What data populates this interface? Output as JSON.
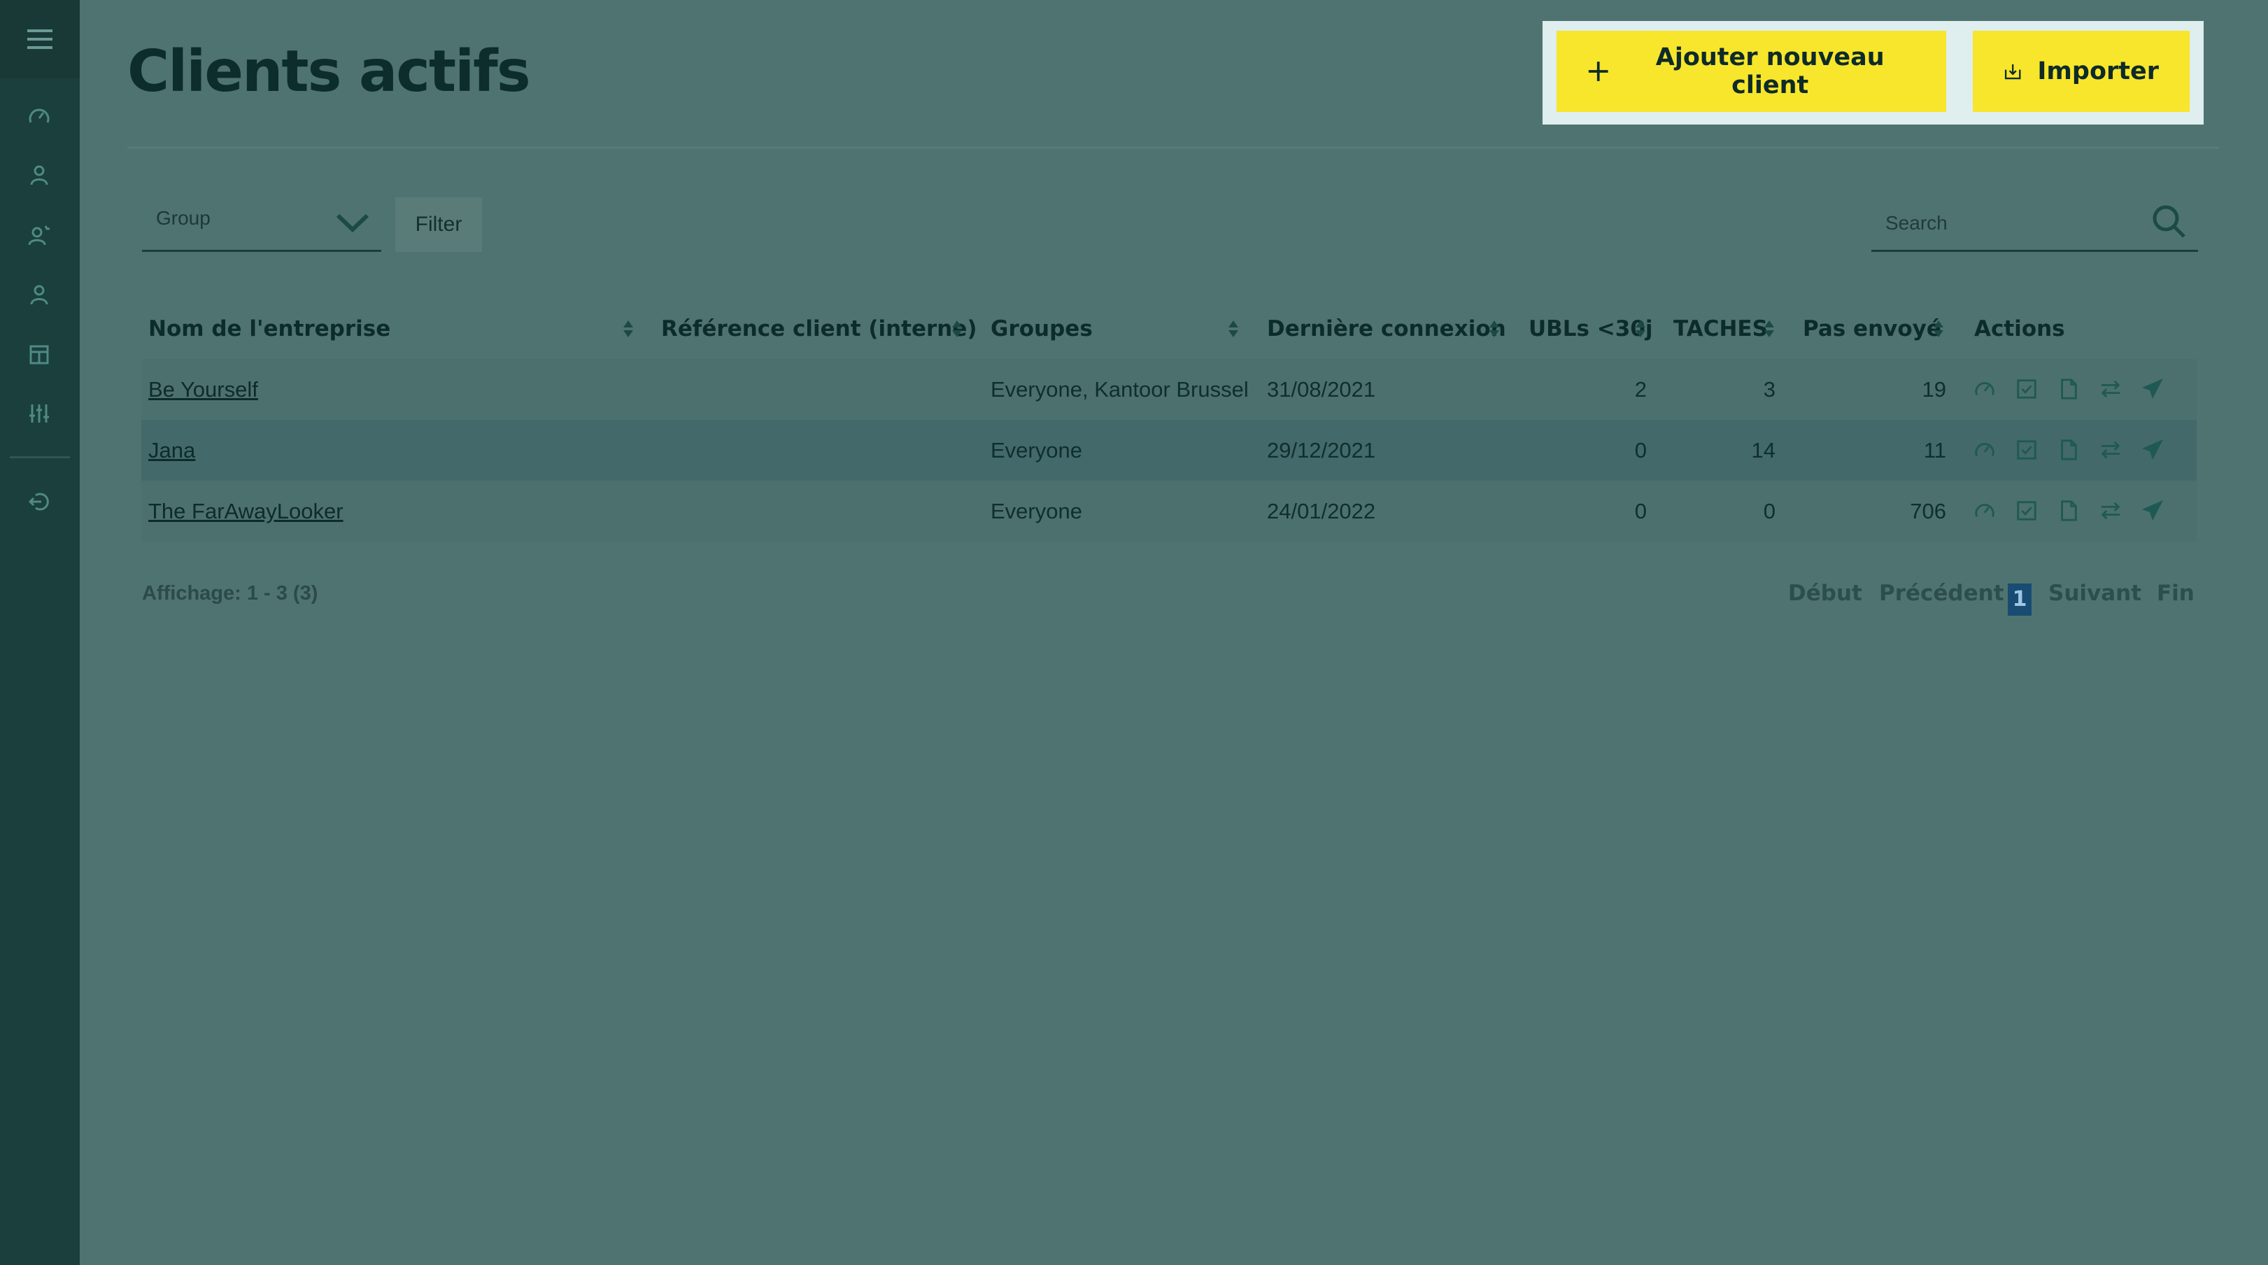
{
  "sidebar": {
    "icons": [
      "menu-icon",
      "dashboard-icon",
      "user-icon",
      "user-star-icon",
      "user-group-icon",
      "shop-icon",
      "sliders-icon",
      "logout-icon"
    ]
  },
  "header": {
    "title": "Clients actifs",
    "add_button": "Ajouter nouveau client",
    "import_button": "Importer"
  },
  "filters": {
    "group_label": "Group",
    "filter_button": "Filter",
    "search_placeholder": "Search"
  },
  "table": {
    "columns": {
      "company": "Nom de l'entreprise",
      "reference": "Référence client (interne)",
      "groups": "Groupes",
      "last_login": "Dernière connexion",
      "ubls": "UBLs <30j",
      "tasks": "TACHES",
      "not_sent": "Pas envoyé",
      "actions": "Actions"
    },
    "rows": [
      {
        "company": "Be Yourself",
        "reference": "",
        "groups": "Everyone, Kantoor Brussel",
        "last_login": "31/08/2021",
        "ubls": "2",
        "tasks": "3",
        "not_sent": "19"
      },
      {
        "company": "Jana",
        "reference": "",
        "groups": "Everyone",
        "last_login": "29/12/2021",
        "ubls": "0",
        "tasks": "14",
        "not_sent": "11"
      },
      {
        "company": "The FarAwayLooker",
        "reference": "",
        "groups": "Everyone",
        "last_login": "24/01/2022",
        "ubls": "0",
        "tasks": "0",
        "not_sent": "706"
      }
    ],
    "action_icons": [
      "dashboard-icon",
      "checkbox-icon",
      "document-icon",
      "transfer-icon",
      "send-icon"
    ]
  },
  "footer": {
    "display_count": "Affichage: 1 - 3 (3)",
    "pagination": {
      "first": "Début",
      "previous": "Précédent",
      "current": "1",
      "next": "Suivant",
      "last": "Fin"
    }
  },
  "colors": {
    "background": "#4f7370",
    "sidebar": "#1a3f3c",
    "accent_button": "#f7e62b",
    "current_page": "#184c73"
  }
}
